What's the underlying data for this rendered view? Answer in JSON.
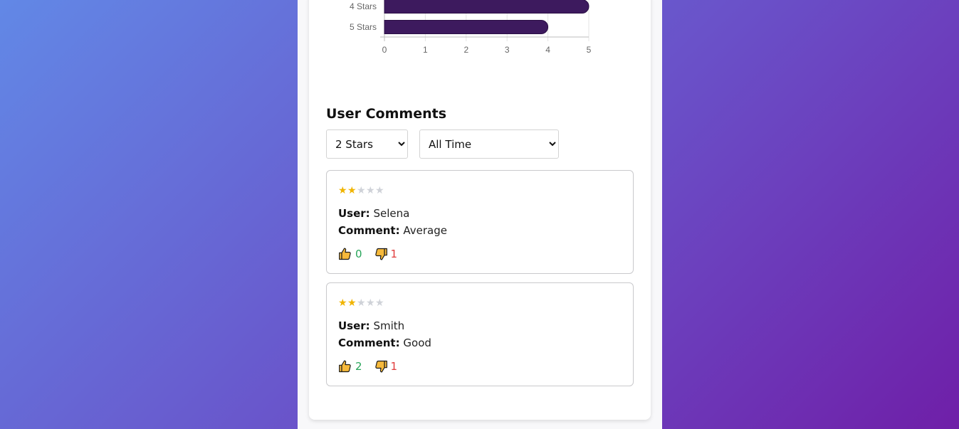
{
  "chart_data": {
    "type": "bar",
    "orientation": "horizontal",
    "categories": [
      "4 Stars",
      "5 Stars"
    ],
    "values": [
      5,
      4
    ],
    "xlim": [
      0,
      5
    ],
    "x_ticks": [
      "0",
      "1",
      "2",
      "3",
      "4",
      "5"
    ],
    "bar_color": "#3d1a5e",
    "grid": true
  },
  "comments_section": {
    "title": "User Comments",
    "rating_filter": {
      "selected": "2 Stars"
    },
    "time_filter": {
      "selected": "All Time"
    },
    "comments": [
      {
        "rating": 2,
        "max_rating": 5,
        "user_label": "User:",
        "user": "Selena",
        "comment_label": "Comment:",
        "comment": "Average",
        "likes": "0",
        "dislikes": "1"
      },
      {
        "rating": 2,
        "max_rating": 5,
        "user_label": "User:",
        "user": "Smith",
        "comment_label": "Comment:",
        "comment": "Good",
        "likes": "2",
        "dislikes": "1"
      }
    ]
  },
  "icons": {
    "like": "thumbs-up-icon",
    "dislike": "thumbs-down-icon",
    "star": "star-icon"
  },
  "colors": {
    "star_filled": "#f0b400",
    "star_empty": "#cfd2d8",
    "like_count": "#28a55a",
    "dislike_count": "#e03c3c"
  }
}
